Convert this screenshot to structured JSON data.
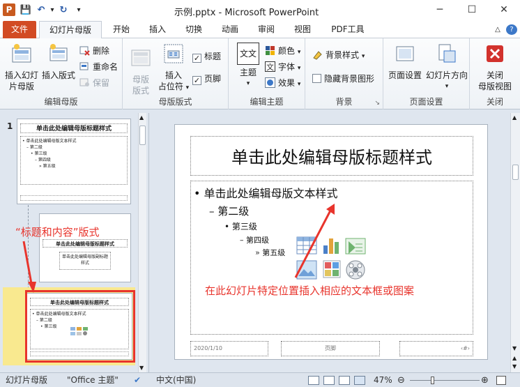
{
  "window": {
    "title": "示例.pptx - Microsoft PowerPoint",
    "app_logo": "P",
    "minimize_glyph": "─",
    "maximize_glyph": "☐",
    "close_glyph": "✕"
  },
  "quick_access": [
    {
      "name": "save-icon",
      "glyph": "💾"
    },
    {
      "name": "undo-icon",
      "glyph": "↶"
    },
    {
      "name": "undo-dropdown-icon",
      "glyph": "▾"
    },
    {
      "name": "redo-icon",
      "glyph": "↻"
    },
    {
      "name": "customize-icon",
      "glyph": "▾"
    }
  ],
  "tabs": {
    "file": "文件",
    "slide_master": "幻灯片母版",
    "others": [
      "开始",
      "插入",
      "切换",
      "动画",
      "审阅",
      "视图",
      "PDF工具"
    ],
    "help_glyph": "?",
    "collapse_glyph": "△"
  },
  "ribbon": {
    "edit_master": {
      "label": "编辑母版",
      "insert_slide_master": [
        "插入幻灯",
        "片母版"
      ],
      "insert_layout": "插入版式",
      "delete": "删除",
      "rename": "重命名",
      "preserve": "保留"
    },
    "master_layout": {
      "label": "母版版式",
      "master_layout_btn": [
        "母版",
        "版式"
      ],
      "insert_placeholder": [
        "插入",
        "占位符"
      ],
      "title_check": "标题",
      "footer_check": "页脚",
      "check_glyph": "✓"
    },
    "edit_theme": {
      "label": "编辑主题",
      "themes": "主题",
      "theme_glyph": "文文",
      "colors": "颜色",
      "fonts": "字体",
      "effects": "效果"
    },
    "background": {
      "label": "背景",
      "background_styles": "背景样式",
      "hide_bg_graphics": "隐藏背景图形",
      "launcher_glyph": "↘"
    },
    "page_setup": {
      "label": "页面设置",
      "page_setup_btn": "页面设置",
      "slide_orientation": "幻灯片方向"
    },
    "close": {
      "label": "关闭",
      "close_master_view": [
        "关闭",
        "母版视图"
      ]
    }
  },
  "thumbnails": {
    "master_number": "1",
    "master_title": "单击此处编辑母版标题样式",
    "master_body_lines": [
      "• 单击此处编辑母版文本样式",
      "– 第二级",
      "• 第三级",
      "– 第四级",
      "» 第五级"
    ],
    "layout1_title": "单击此处编辑母版标题样式",
    "layout1_sub": "单击此处编辑母版副标题样式",
    "layout2_title": "单击此处编辑母版标题样式",
    "layout2_body_lines": [
      "• 单击此处编辑母版文本样式",
      "– 第二级",
      "• 第三级"
    ]
  },
  "slide": {
    "title": "单击此处编辑母版标题样式",
    "level1": "• 单击此处编辑母版文本样式",
    "level2": "– 第二级",
    "level3": "• 第三级",
    "level4": "– 第四级",
    "level5": "» 第五级",
    "footer_date": "2020/1/10",
    "footer_text": "页脚",
    "footer_number": "‹#›"
  },
  "annotations": {
    "layout_label": "“标题和内容”版式",
    "insert_hint": "在此幻灯片特定位置插入相应的文本框或图案"
  },
  "status_bar": {
    "view_name": "幻灯片母版",
    "theme": "\"Office 主题\"",
    "language": "中文(中国)",
    "zoom": "47%",
    "minus_glyph": "⊖",
    "plus_glyph": "⊕"
  },
  "colors": {
    "accent": "#d24b24",
    "annotation": "#e8342c",
    "selection": "#e8342c"
  }
}
